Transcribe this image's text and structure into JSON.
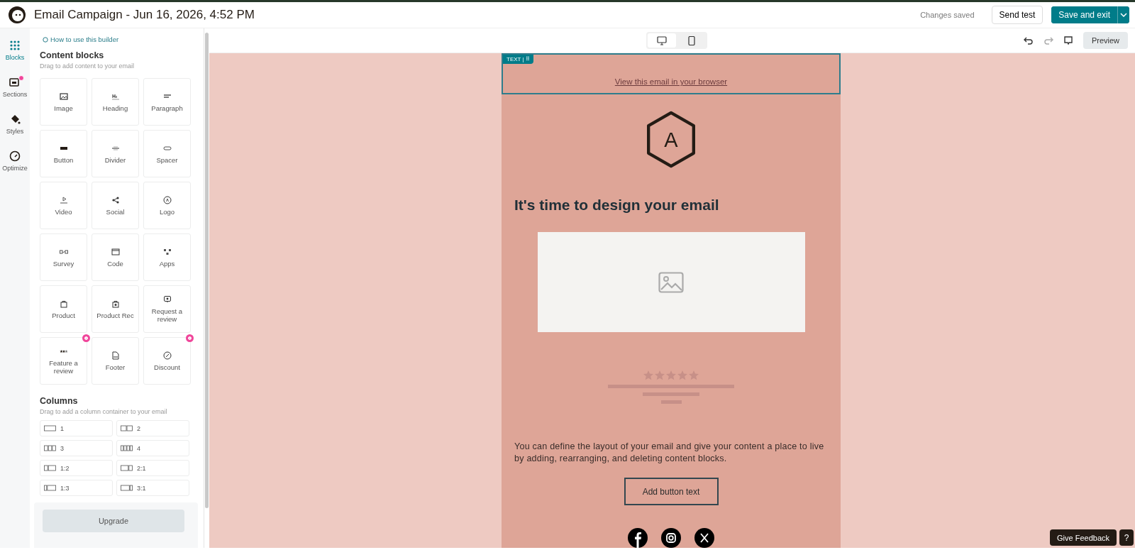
{
  "header": {
    "title": "Email Campaign - Jun 16, 2026, 4:52 PM",
    "save_status": "Changes saved",
    "send_test": "Send test",
    "save_exit": "Save and exit"
  },
  "rail": [
    {
      "kind": "blocks",
      "label": "Blocks",
      "selected": true,
      "badge": false
    },
    {
      "kind": "sections",
      "label": "Sections",
      "selected": false,
      "badge": true
    },
    {
      "kind": "styles",
      "label": "Styles",
      "selected": false,
      "badge": false
    },
    {
      "kind": "optimize",
      "label": "Optimize",
      "selected": false,
      "badge": false
    }
  ],
  "panel": {
    "help_link": "How to use this builder",
    "blocks_title": "Content blocks",
    "blocks_hint": "Drag to add content to your email",
    "blocks": [
      {
        "kind": "image",
        "label": "Image",
        "badge": false
      },
      {
        "kind": "heading",
        "label": "Heading",
        "badge": false
      },
      {
        "kind": "paragraph",
        "label": "Paragraph",
        "badge": false
      },
      {
        "kind": "button",
        "label": "Button",
        "badge": false
      },
      {
        "kind": "divider",
        "label": "Divider",
        "badge": false
      },
      {
        "kind": "spacer",
        "label": "Spacer",
        "badge": false
      },
      {
        "kind": "video",
        "label": "Video",
        "badge": false
      },
      {
        "kind": "social",
        "label": "Social",
        "badge": false
      },
      {
        "kind": "logo",
        "label": "Logo",
        "badge": false
      },
      {
        "kind": "survey",
        "label": "Survey",
        "badge": false
      },
      {
        "kind": "code",
        "label": "Code",
        "badge": false
      },
      {
        "kind": "apps",
        "label": "Apps",
        "badge": false
      },
      {
        "kind": "product",
        "label": "Product",
        "badge": false
      },
      {
        "kind": "productrec",
        "label": "Product Rec",
        "badge": false
      },
      {
        "kind": "request",
        "label": "Request a review",
        "badge": false
      },
      {
        "kind": "feature",
        "label": "Feature a review",
        "badge": true
      },
      {
        "kind": "footer",
        "label": "Footer",
        "badge": false
      },
      {
        "kind": "discount",
        "label": "Discount",
        "badge": true
      }
    ],
    "columns_title": "Columns",
    "columns_hint": "Drag to add a column container to your email",
    "columns": [
      {
        "label": "1",
        "kind": "one"
      },
      {
        "label": "2",
        "kind": "two"
      },
      {
        "label": "3",
        "kind": "three"
      },
      {
        "label": "4",
        "kind": "four"
      },
      {
        "label": "1:2",
        "kind": "onetwo"
      },
      {
        "label": "2:1",
        "kind": "twoone"
      },
      {
        "label": "1:3",
        "kind": "onethree"
      },
      {
        "label": "3:1",
        "kind": "threeone"
      }
    ],
    "upgrade": "Upgrade"
  },
  "toolbar": {
    "devices": [
      {
        "kind": "desktop",
        "selected": true
      },
      {
        "kind": "mobile",
        "selected": false
      }
    ],
    "preview": "Preview"
  },
  "email": {
    "block_tag": "TEXT | ⠿",
    "browser_link": "View this email in your browser",
    "logo_letter": "A",
    "heading": "It's time to design your email",
    "body": "You can define the layout of your email and give your content a place to live by adding, rearranging, and deleting content blocks.",
    "button": "Add button text",
    "social": [
      {
        "kind": "facebook"
      },
      {
        "kind": "instagram"
      },
      {
        "kind": "x"
      }
    ]
  },
  "feedback": {
    "label": "Give Feedback",
    "help": "?"
  }
}
